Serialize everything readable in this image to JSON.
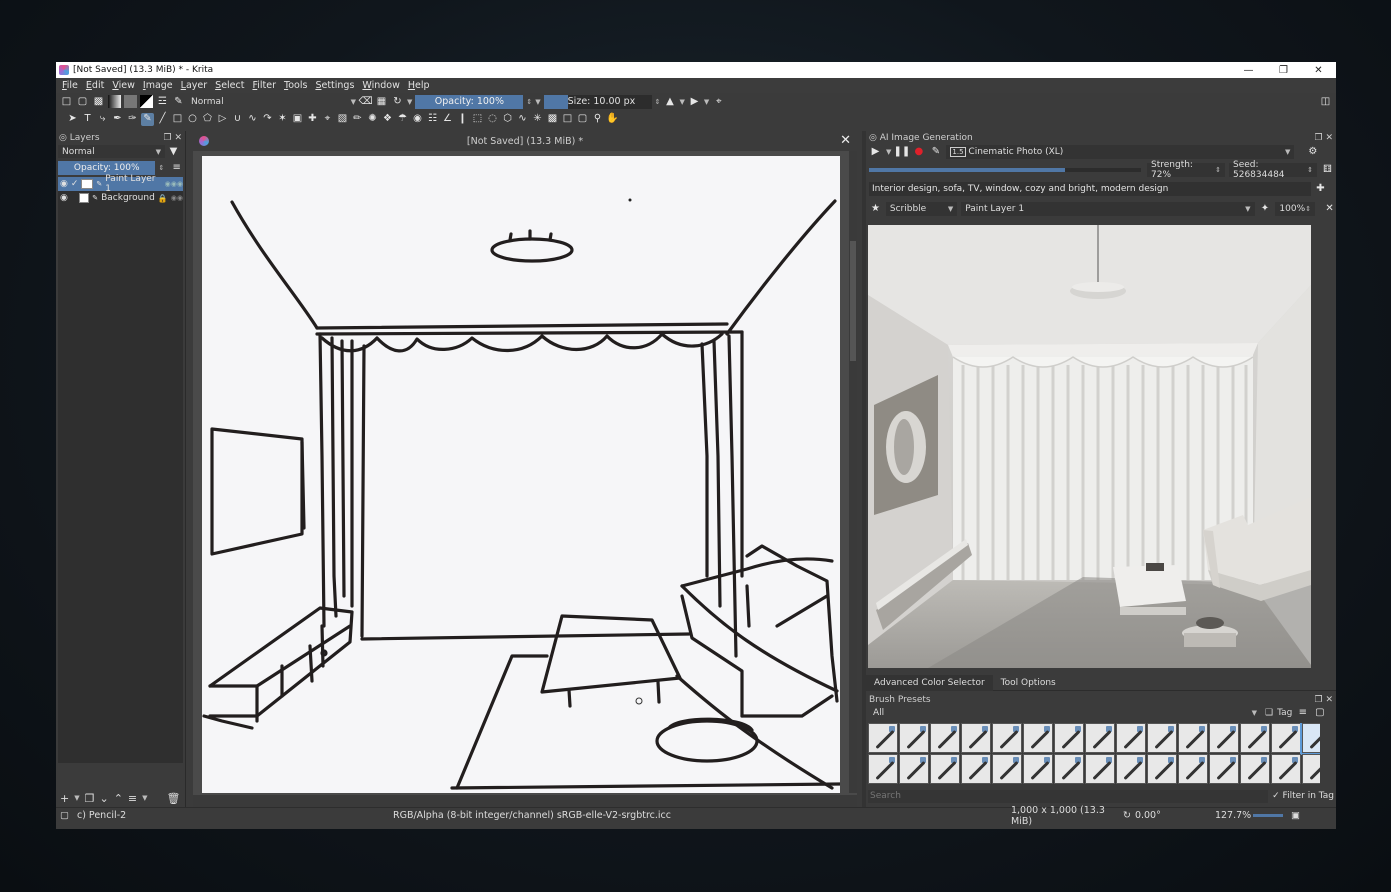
{
  "window": {
    "title": "[Not Saved]  (13.3 MiB) * - Krita"
  },
  "menu": [
    "File",
    "Edit",
    "View",
    "Image",
    "Layer",
    "Select",
    "Filter",
    "Tools",
    "Settings",
    "Window",
    "Help"
  ],
  "toolbar": {
    "blend_mode": "Normal",
    "opacity": "Opacity: 100%",
    "size": "Size: 10.00 px",
    "size_fraction": 0.12
  },
  "layers": {
    "title": "Layers",
    "blend_mode": "Normal",
    "opacity": "Opacity:  100%",
    "items": [
      {
        "name": "Paint Layer 1",
        "active": true
      },
      {
        "name": "Background",
        "active": false
      }
    ]
  },
  "canvas": {
    "tab_title": "[Not Saved]  (13.3 MiB) *"
  },
  "ai": {
    "title": "AI Image Generation",
    "style": "Cinematic Photo (XL)",
    "strength": "Strength: 72%",
    "strength_fraction": 0.72,
    "seed": "Seed: 526834484",
    "prompt": "Interior design, sofa, TV, window, cozy and bright, modern design",
    "control_mode": "Scribble",
    "control_layer": "Paint Layer 1",
    "control_strength": "100%",
    "badge": "1.5"
  },
  "dock_tabs": [
    "Advanced Color Selector",
    "Tool Options"
  ],
  "brush_presets": {
    "title": "Brush Presets",
    "filter": "All",
    "tag_label": "Tag",
    "search_placeholder": "Search",
    "filter_in_tag": "Filter in Tag"
  },
  "status": {
    "brush": "c) Pencil-2",
    "color_space": "RGB/Alpha (8-bit integer/channel)  sRGB-elle-V2-srgbtrc.icc",
    "dimensions": "1,000 x 1,000 (13.3 MiB)",
    "rotation": "0.00°",
    "zoom": "127.7%"
  }
}
